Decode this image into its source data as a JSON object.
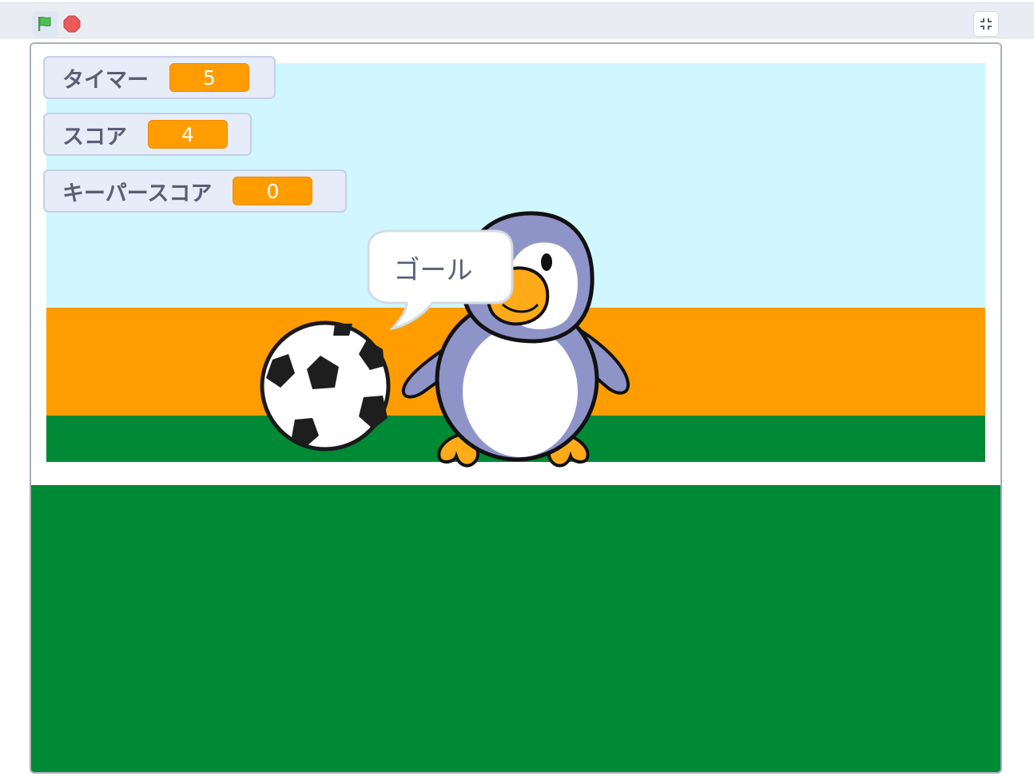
{
  "toolbar": {
    "green_flag_icon": "green-flag-icon",
    "stop_icon": "stop-icon",
    "shrink_icon": "shrink-stage-icon"
  },
  "monitors": [
    {
      "label": "タイマー",
      "value": "5"
    },
    {
      "label": "スコア",
      "value": "4"
    },
    {
      "label": "キーパースコア",
      "value": "0"
    }
  ],
  "sprites": {
    "penguin": {
      "speech": "ゴール"
    },
    "ball": {
      "name": "soccer-ball"
    }
  },
  "colors": {
    "sky": "#cff7fd",
    "orange_band": "#ff9d00",
    "grass": "#008a36",
    "monitor_value": "#ff9d00",
    "green_flag": "#4cbf56",
    "stop": "#ec5959"
  }
}
